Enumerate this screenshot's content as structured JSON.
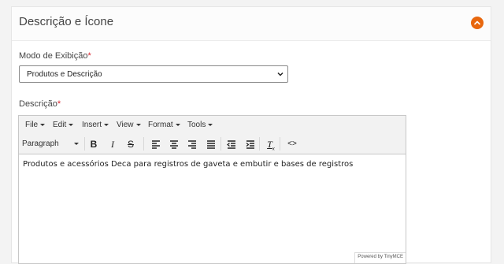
{
  "section": {
    "title": "Descrição e Ícone",
    "accent_color": "#e8670e"
  },
  "display_mode": {
    "label": "Modo de Exibição",
    "required_marker": "*",
    "selected_value": "Produtos e Descrição"
  },
  "description": {
    "label": "Descrição",
    "required_marker": "*"
  },
  "editor": {
    "menus": [
      "File",
      "Edit",
      "Insert",
      "View",
      "Format",
      "Tools"
    ],
    "block_format": "Paragraph",
    "toolbar_icons": [
      "bold-icon",
      "italic-icon",
      "strikethrough-icon",
      "align-left-icon",
      "align-center-icon",
      "align-right-icon",
      "align-justify-icon",
      "outdent-icon",
      "indent-icon",
      "clear-formatting-icon",
      "source-code-icon"
    ],
    "content": "Produtos e acessórios Deca para registros de gaveta e embutir e bases de registros",
    "powered_by": "Powered by TinyMCE"
  }
}
